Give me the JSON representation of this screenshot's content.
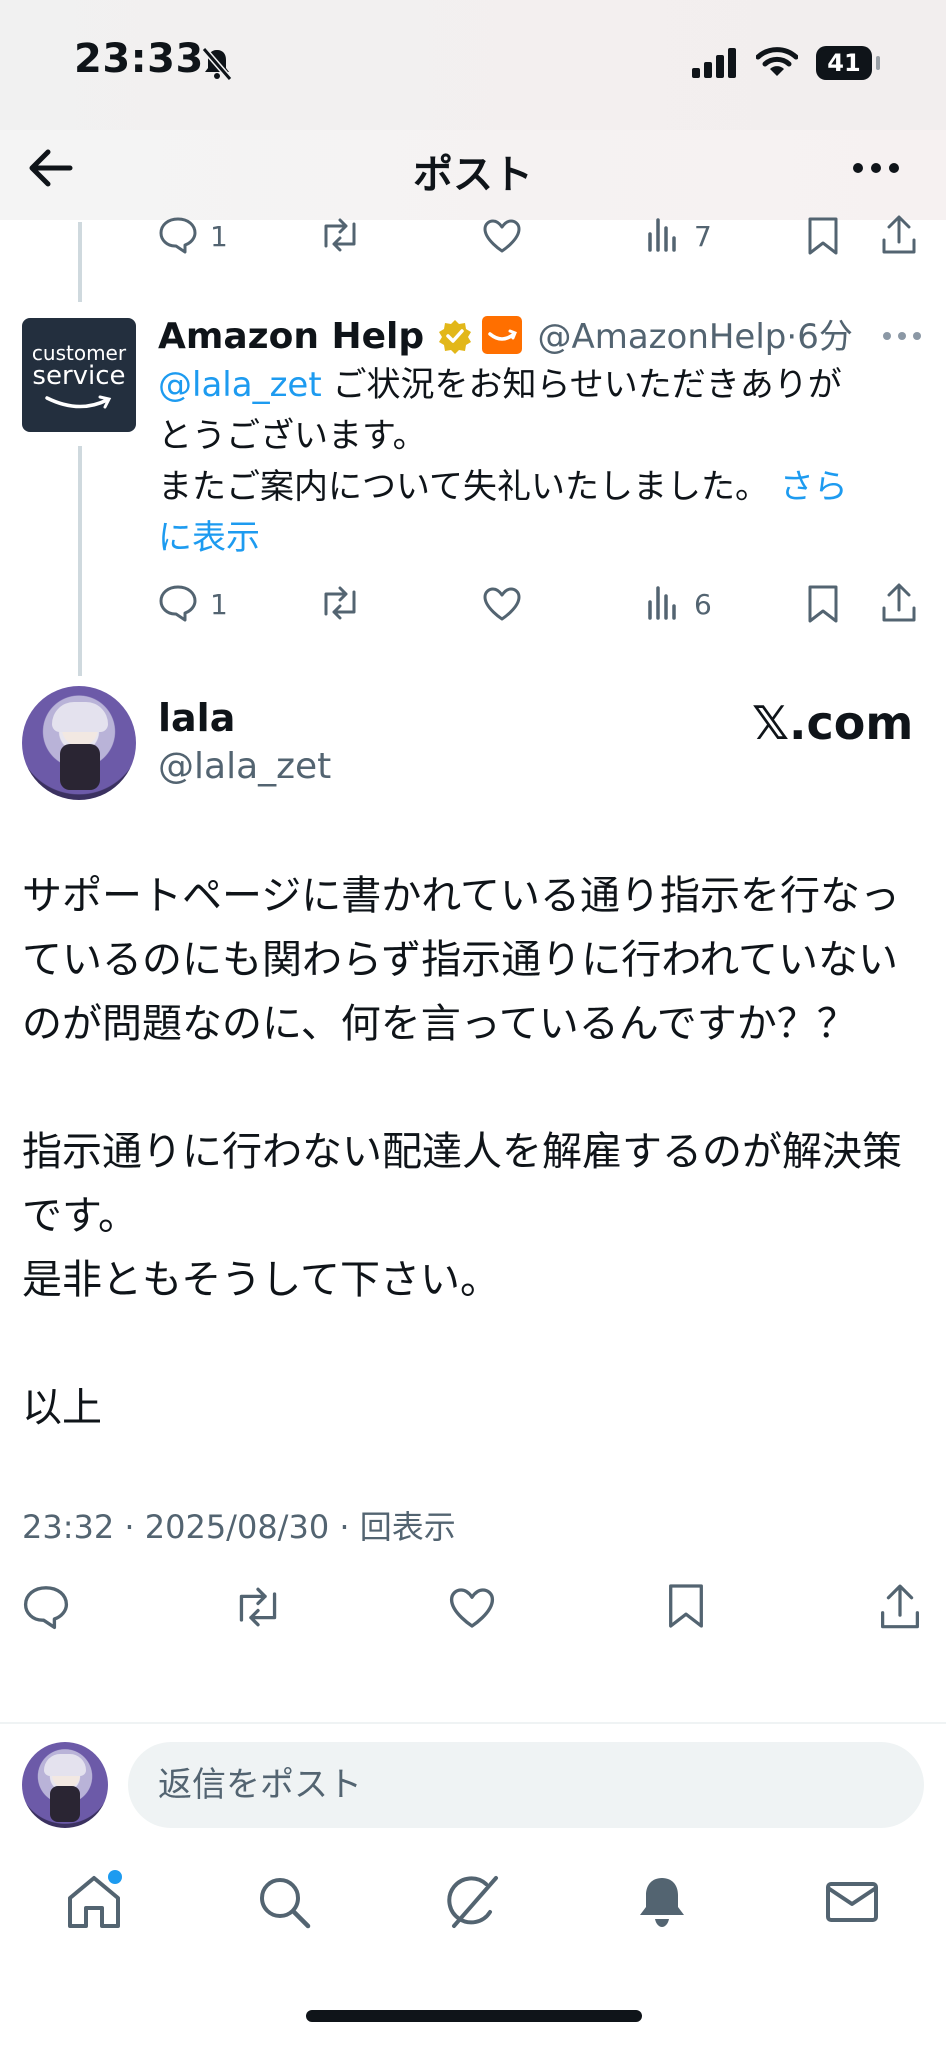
{
  "status": {
    "time": "23:33",
    "battery": "41"
  },
  "header": {
    "title": "ポスト"
  },
  "prev_actions": {
    "reply_count": "1",
    "views_count": "7"
  },
  "reply_tweet": {
    "author_name": "Amazon Help",
    "avatar_line1": "customer",
    "avatar_line2": "service",
    "handle": "@AmazonHelp",
    "time": "6分",
    "mention": "@lala_zet",
    "line1": " ご状況をお知らせいただきありが",
    "line2": "とうございます。",
    "line3": "またご案内について失礼いたしました。 ",
    "show_more_a": "さら",
    "show_more_b": "に表示",
    "reply_count": "1",
    "views_count": "6"
  },
  "main_tweet": {
    "author_name": "lala",
    "handle": "@lala_zet",
    "source_logo": "𝕏.com",
    "lines": [
      "サポートページに書かれている通り指示を行なっ",
      "ているのにも関わらず指示通りに行われていない",
      "のが問題なのに、何を言っているんですか？？",
      "",
      "指示通りに行わない配達人を解雇するのが解決策",
      "です。",
      "是非ともそうして下さい。",
      "",
      "以上"
    ],
    "meta": "23:32 · 2025/08/30 · 回表示"
  },
  "reply_box": {
    "placeholder": "返信をポスト"
  },
  "colors": {
    "link": "#1d9bf0",
    "muted": "#536471",
    "verified": "#e2b719",
    "amazon": "#ff6f00",
    "avatar_bg": "#232f3e"
  },
  "icons": [
    "back-arrow-icon",
    "more-icon",
    "reply-icon",
    "repost-icon",
    "like-icon",
    "views-icon",
    "bookmark-icon",
    "share-icon",
    "home-icon",
    "search-icon",
    "grok-icon",
    "bell-icon",
    "mail-icon"
  ]
}
